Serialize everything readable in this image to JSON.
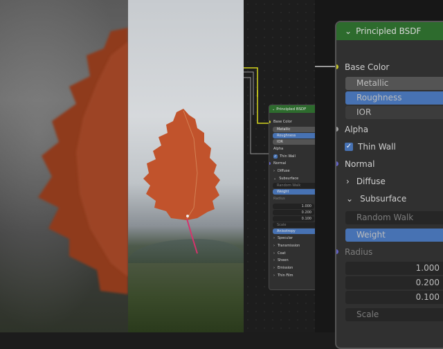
{
  "node": {
    "title": "Principled BSDF",
    "base_color": "Base Color",
    "metallic": "Metallic",
    "roughness": "Roughness",
    "ior": "IOR",
    "alpha": "Alpha",
    "thin_wall": "Thin Wall",
    "normal": "Normal",
    "diffuse": "Diffuse",
    "subsurface": "Subsurface",
    "subsurface_method": "Random Walk",
    "weight": "Weight",
    "radius": "Radius",
    "radius_values": [
      "1.000",
      "0.200",
      "0.100"
    ],
    "scale": "Scale",
    "anisotropy": "Anisotropy",
    "specular": "Specular",
    "transmission": "Transmission",
    "coat": "Coat",
    "sheen": "Sheen",
    "emission": "Emission",
    "thin_film": "Thin Film"
  },
  "icons": {
    "collapse": "chevron-down-icon",
    "expand": "chevron-right-icon",
    "checkbox": "checkmark-icon"
  },
  "colors": {
    "node_header": "#2d6b2d",
    "field_blue": "#4772b3",
    "socket_yellow": "#c7c729",
    "socket_gray": "#a1a1a1",
    "socket_purple": "#6363c7",
    "wire_yellow": "#d6d61e",
    "leaf": "#c1532c"
  }
}
